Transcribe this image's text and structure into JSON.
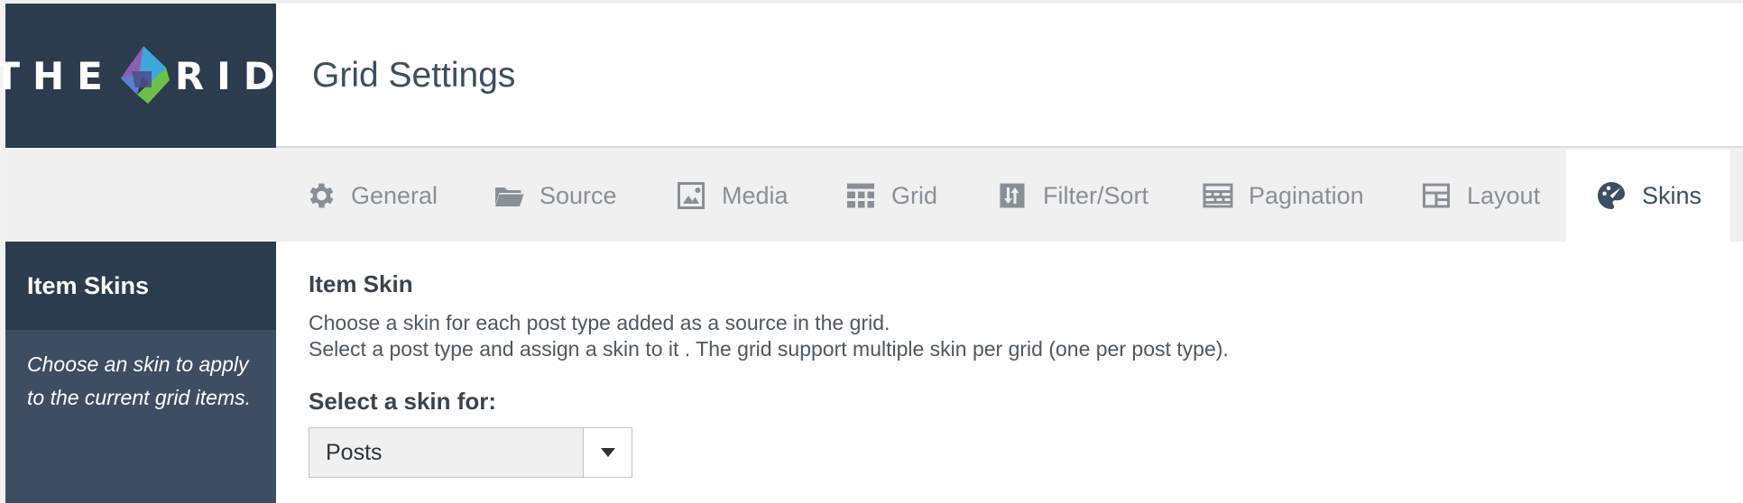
{
  "logo": {
    "left": "THE",
    "right": "RID"
  },
  "header": {
    "title": "Grid Settings"
  },
  "tabs": [
    {
      "label": "General",
      "icon": "gear-icon"
    },
    {
      "label": "Source",
      "icon": "folder-icon"
    },
    {
      "label": "Media",
      "icon": "image-icon"
    },
    {
      "label": "Grid",
      "icon": "grid-icon"
    },
    {
      "label": "Filter/Sort",
      "icon": "filter-sort-icon"
    },
    {
      "label": "Pagination",
      "icon": "pagination-icon"
    },
    {
      "label": "Layout",
      "icon": "layout-icon"
    },
    {
      "label": "Skins",
      "icon": "palette-icon",
      "active": true
    }
  ],
  "sidebar": {
    "title": "Item Skins",
    "description": "Choose an skin to apply to the current grid items."
  },
  "main": {
    "section_title": "Item Skin",
    "description_line1": "Choose a skin for each post type added as a source in the grid.",
    "description_line2": "Select a post type and assign a skin to it . The grid support multiple skin per grid (one per post type).",
    "select_label": "Select a skin for:",
    "select_value": "Posts"
  },
  "colors": {
    "logo_bg": "#2c3b4e",
    "sidebar_bg": "#3d4e63",
    "active_tab_text": "#3d4e63",
    "inactive_tab_text": "#8a8f96"
  }
}
